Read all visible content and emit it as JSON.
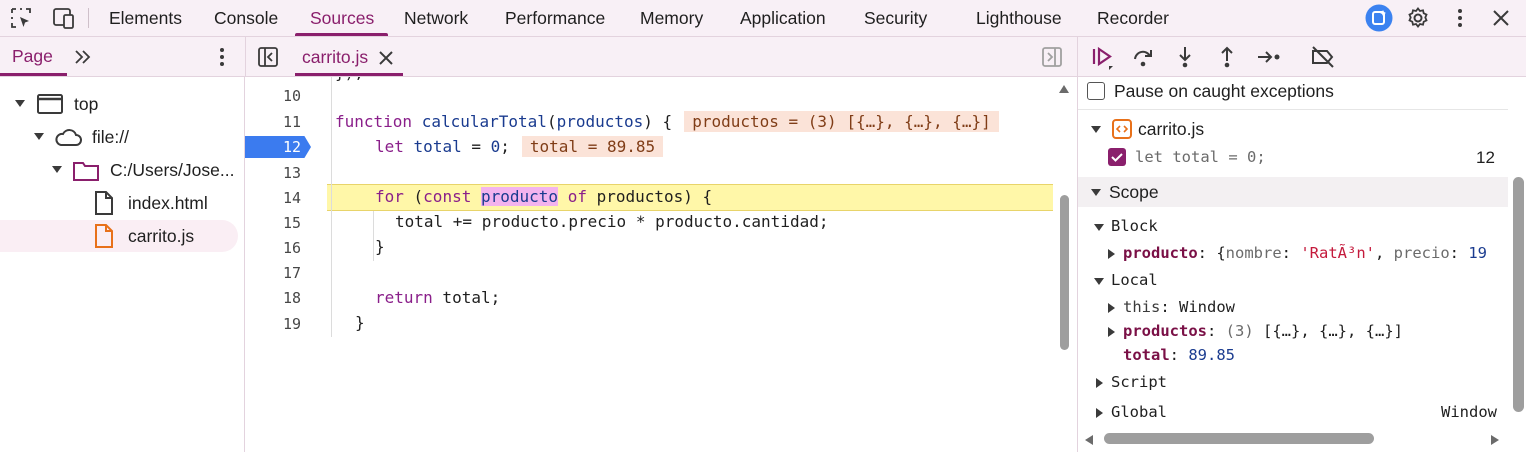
{
  "topbar": {
    "tabs": [
      {
        "label": "Elements"
      },
      {
        "label": "Console"
      },
      {
        "label": "Sources"
      },
      {
        "label": "Network"
      },
      {
        "label": "Performance"
      },
      {
        "label": "Memory"
      },
      {
        "label": "Application"
      },
      {
        "label": "Security"
      },
      {
        "label": "Lighthouse"
      },
      {
        "label": "Recorder"
      }
    ],
    "active_tab": "Sources",
    "icons": [
      "inspect-element-icon",
      "device-toggle-icon",
      "ai-assistance-icon",
      "settings-gear-icon",
      "more-vert-icon",
      "close-icon"
    ]
  },
  "navigator": {
    "tab_label": "Page",
    "tree": [
      {
        "label": "top"
      },
      {
        "label": "file://"
      },
      {
        "label": "C:/Users/Jose..."
      },
      {
        "label": "index.html"
      },
      {
        "label": "carrito.js"
      }
    ],
    "selected": "carrito.js"
  },
  "editor": {
    "open_file": "carrito.js",
    "line_numbers": [
      "10",
      "11",
      "12",
      "13",
      "14",
      "15",
      "16",
      "17",
      "18",
      "19"
    ],
    "breakpoint_line": "12",
    "lines": {
      "l9": "});",
      "l11_kw": "function",
      "l11_fn": "calcularTotal",
      "l11_open": "(",
      "l11_param": "productos",
      "l11_close": ") {",
      "l11_inline": "productos = (3) [{…}, {…}, {…}]",
      "l12_kw": "let",
      "l12_var": "total",
      "l12_eq": " = ",
      "l12_num": "0",
      "l12_semi": ";",
      "l12_inline": "total = 89.85",
      "l14_kw1": "for",
      "l14_open": " (",
      "l14_kw2": "const",
      "l14_var": "producto",
      "l14_kw3": "of",
      "l14_rest": " productos) {",
      "l15": "total += producto.precio * producto.cantidad;",
      "l16": "}",
      "l18_kw": "return",
      "l18_rest": " total;",
      "l19": "}"
    }
  },
  "debugger": {
    "pause_caught_label": "Pause on caught exceptions",
    "breakpoints": {
      "file": "carrito.js",
      "entry_code": "let total = 0;",
      "entry_line": "12"
    },
    "scope": {
      "title": "Scope",
      "block_label": "Block",
      "block_prop_name": "producto",
      "block_prop_sep": ": ",
      "block_prop_open": "{",
      "block_prop_k1": "nombre",
      "block_prop_colon1": ": ",
      "block_prop_v1": "'RatÃ³n'",
      "block_prop_comma": ", ",
      "block_prop_k2": "precio",
      "block_prop_colon2": ": ",
      "block_prop_v2": "19",
      "local_label": "Local",
      "this_name": "this",
      "this_sep": ": ",
      "this_value": "Window",
      "productos_name": "productos",
      "productos_sep": ": ",
      "productos_count": "(3)",
      "productos_value": " [{…}, {…}, {…}]",
      "total_name": "total",
      "total_sep": ": ",
      "total_value": "89.85",
      "script_label": "Script",
      "global_label": "Global",
      "global_value": "Window"
    }
  }
}
